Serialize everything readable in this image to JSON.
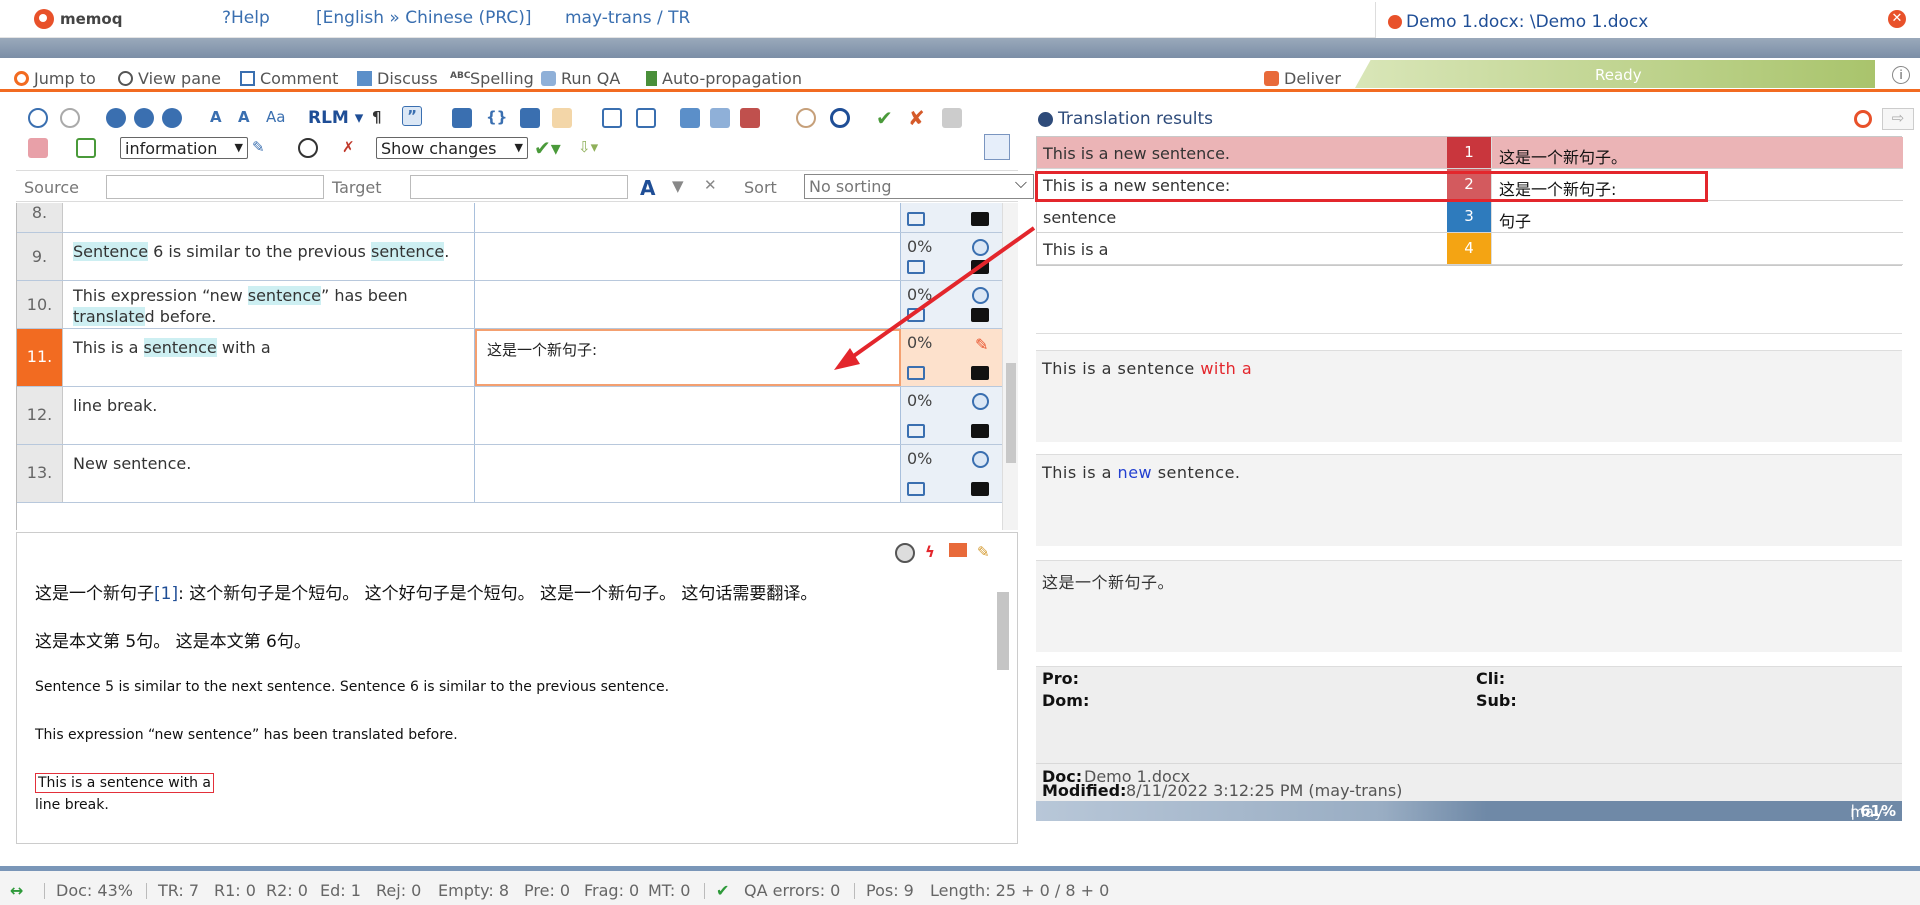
{
  "app": {
    "name": "memoq",
    "help": "?Help",
    "language_pair": "[English » Chinese (PRC)]",
    "user_tr": "may-trans / TR"
  },
  "document_tab": {
    "title": "Demo 1.docx: \\Demo 1.docx",
    "close": "✕"
  },
  "commands": {
    "jump_to": "Jump to",
    "view_pane": "View pane",
    "comment": "Comment",
    "discuss": "Discuss",
    "spelling": "Spelling",
    "run_qa": "Run QA",
    "auto_propagation": "Auto-propagation",
    "deliver": "Deliver",
    "status": "Ready"
  },
  "toolbar": {
    "rlm": "RLM",
    "info_select": "information",
    "changes_select": "Show changes"
  },
  "filter": {
    "source_label": "Source",
    "target_label": "Target",
    "sort_label": "Sort",
    "sort_value": "No sorting"
  },
  "grid": {
    "rows": [
      {
        "num": "8.",
        "status": ""
      },
      {
        "num": "9.",
        "status": "0%"
      },
      {
        "num": "10.",
        "status": "0%"
      },
      {
        "num": "11.",
        "target": "这是一个新句子:",
        "status": "0%"
      },
      {
        "num": "12.",
        "source": "line break.",
        "status": "0%"
      },
      {
        "num": "13.",
        "source": "New sentence.",
        "status": "0%"
      }
    ],
    "row9": {
      "a": "Sentence",
      "b": " 6 is similar to the previous ",
      "c": "sentence",
      "d": "."
    },
    "row10": {
      "a": "This expression “new ",
      "b": "sentence",
      "c": "” has been",
      "d": "translate",
      "e": "d before."
    },
    "row11": {
      "a": "This is a ",
      "b": "sentence",
      "c": " with a"
    }
  },
  "preview": {
    "line1_a": "这是一个新句子",
    "line1_tag": "[1]",
    "line1_b": ":  这个新句子是个短句。 这个好句子是个短句。 这是一个新句子。 这句话需要翻译。",
    "line2": "这是本文第 5句。 这是本文第 6句。",
    "line3": "Sentence 5 is similar to the next sentence. Sentence 6 is similar to the previous sentence.",
    "line4": "This expression “new sentence” has been translated before.",
    "line5": "This is a sentence with a",
    "line6": "line break."
  },
  "translation_results": {
    "title": "Translation results",
    "items": [
      {
        "source": "This is a new sentence.",
        "num": "1",
        "target": "这是一个新句子。",
        "color": "#c9363d"
      },
      {
        "source": "This is a new sentence:",
        "num": "2",
        "target": "这是一个新句子:",
        "color": "#d35a5e"
      },
      {
        "source": "sentence",
        "num": "3",
        "target": "句子",
        "color": "#2e7bbd"
      },
      {
        "source": "This is a",
        "num": "4",
        "target": "",
        "color": "#f4a413"
      }
    ]
  },
  "compare": {
    "c1_a": "This is a sentence ",
    "c1_b": "with a",
    "c2_a": "This is a ",
    "c2_b": "new",
    "c2_c": " sentence.",
    "c3": "这是一个新句子。"
  },
  "meta": {
    "pro_label": "Pro:",
    "cli_label": "Cli:",
    "dom_label": "Dom:",
    "sub_label": "Sub:",
    "doc_label": "Doc:",
    "doc_value": "Demo 1.docx",
    "modified_label": "Modified:",
    "modified_value": "8/11/2022 3:12:25 PM (may-trans)",
    "progress_label": "may-trans",
    "progress_value": "61%"
  },
  "statusbar": {
    "doc": "Doc: 43%",
    "tr": "TR: 7",
    "r1": "R1: 0",
    "r2": "R2: 0",
    "ed": "Ed: 1",
    "rej": "Rej: 0",
    "empty": "Empty: 8",
    "pre": "Pre: 0",
    "frag": "Frag: 0",
    "mt": "MT: 0",
    "qa": "QA errors: 0",
    "pos": "Pos: 9",
    "length": "Length: 25 + 0 / 8 + 0"
  }
}
